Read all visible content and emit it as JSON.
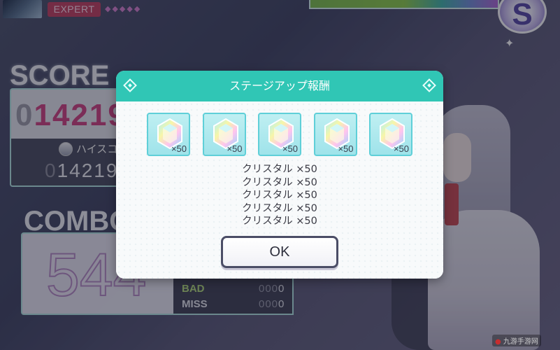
{
  "hud": {
    "difficulty": "EXPERT",
    "difficulty_diamonds": "◆◆◆◆◆",
    "rank": "S",
    "sparkle": "✦"
  },
  "score": {
    "title": "SCORE",
    "value_lead": "0",
    "value": "14219",
    "hiscore_label": "ハイスコ",
    "hiscore_lead": "0",
    "hiscore_value": "14219"
  },
  "combo": {
    "title": "COMBO",
    "value": "544"
  },
  "judgement": {
    "bad_label": "BAD",
    "bad_lead": "000",
    "bad_value": "0",
    "miss_label": "MISS",
    "miss_lead": "000",
    "miss_value": "0"
  },
  "dialog": {
    "title": "ステージアップ報酬",
    "rewards": [
      {
        "icon": "crystal-icon",
        "qty": "×50"
      },
      {
        "icon": "crystal-icon",
        "qty": "×50"
      },
      {
        "icon": "crystal-icon",
        "qty": "×50"
      },
      {
        "icon": "crystal-icon",
        "qty": "×50"
      },
      {
        "icon": "crystal-icon",
        "qty": "×50"
      }
    ],
    "reward_lines": [
      "クリスタル ×50",
      "クリスタル ×50",
      "クリスタル ×50",
      "クリスタル ×50",
      "クリスタル ×50"
    ],
    "ok_label": "OK"
  },
  "watermark": "九游手游网",
  "colors": {
    "header_teal": "#30c6b5",
    "tile_border": "#5fcfd8",
    "expert_red": "#c43b5c",
    "score_pink": "#d13c7f"
  }
}
